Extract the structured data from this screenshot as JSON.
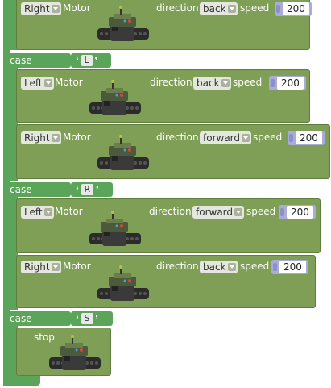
{
  "blocks": [
    {
      "side": "Right",
      "motor": "Motor",
      "direction_label": "direction",
      "direction": "back",
      "speed_label": "speed",
      "speed": "200"
    },
    {
      "side": "Left",
      "motor": "Motor",
      "direction_label": "direction",
      "direction": "back",
      "speed_label": "speed",
      "speed": "200"
    },
    {
      "side": "Right",
      "motor": "Motor",
      "direction_label": "direction",
      "direction": "forward",
      "speed_label": "speed",
      "speed": "200"
    },
    {
      "side": "Left",
      "motor": "Motor",
      "direction_label": "direction",
      "direction": "forward",
      "speed_label": "speed",
      "speed": "200"
    },
    {
      "side": "Right",
      "motor": "Motor",
      "direction_label": "direction",
      "direction": "back",
      "speed_label": "speed",
      "speed": "200"
    }
  ],
  "cases": [
    {
      "label": "case",
      "value": "L"
    },
    {
      "label": "case",
      "value": "R"
    },
    {
      "label": "case",
      "value": "S"
    }
  ],
  "stop": {
    "label": "stop"
  },
  "colors": {
    "spine": "#5ba55b",
    "motor_block": "#7f9f57",
    "number_slot": "#a9acd8"
  }
}
